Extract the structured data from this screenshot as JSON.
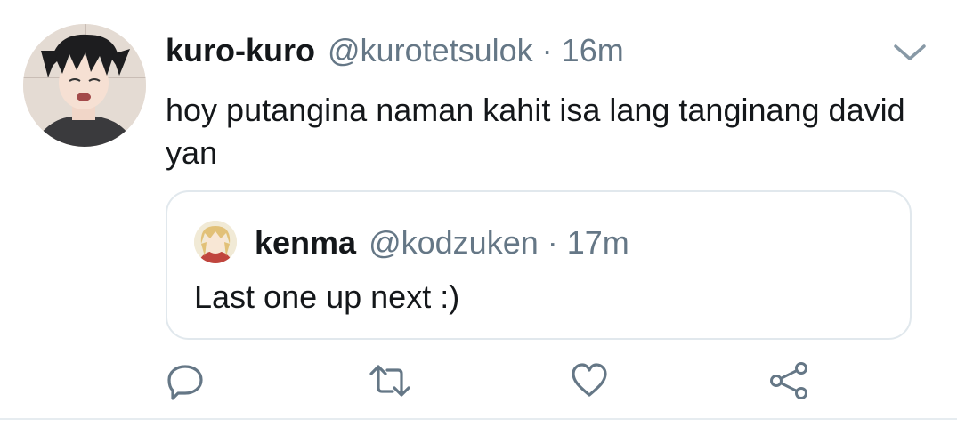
{
  "tweet": {
    "display_name": "kuro-kuro",
    "handle": "@kurotetsulok",
    "separator": "·",
    "time": "16m",
    "text": "hoy putangina naman kahit isa lang tanginang david yan",
    "menu_icon": "chevron-down-icon"
  },
  "quoted_tweet": {
    "display_name": "kenma",
    "handle": "@kodzuken",
    "separator": "·",
    "time": "17m",
    "text": "Last one up next :)"
  },
  "actions": [
    {
      "name": "reply",
      "icon": "reply-icon"
    },
    {
      "name": "retweet",
      "icon": "retweet-icon"
    },
    {
      "name": "like",
      "icon": "heart-icon"
    },
    {
      "name": "share",
      "icon": "share-icon"
    }
  ],
  "colors": {
    "text_primary": "#14171a",
    "text_secondary": "#657786",
    "icon_gray": "#657786",
    "border": "#e1e8ed"
  }
}
